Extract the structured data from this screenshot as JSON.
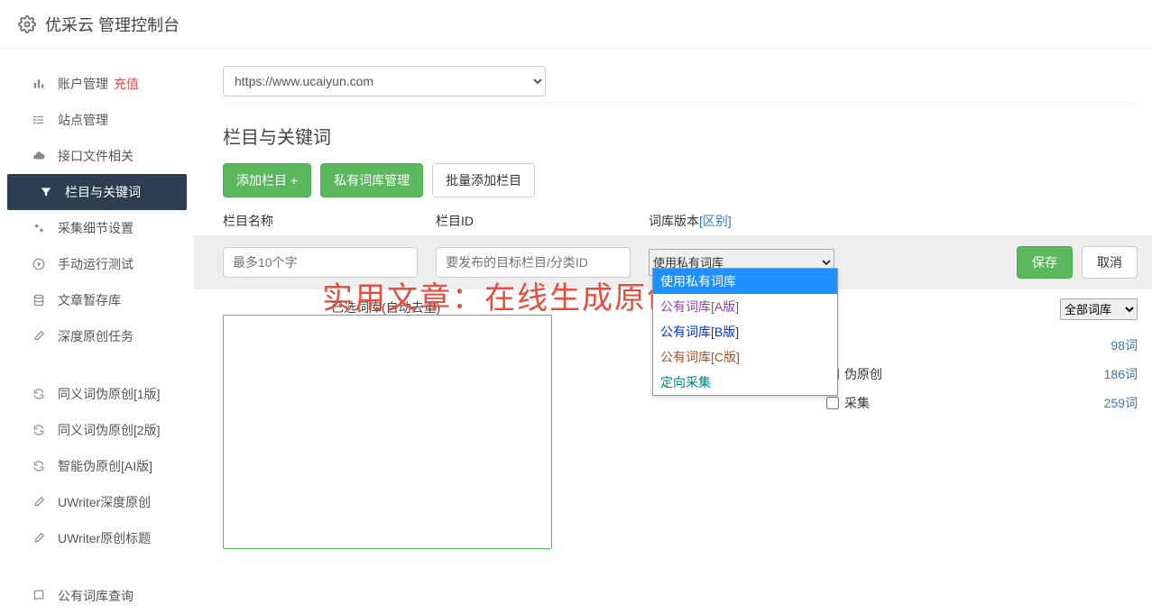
{
  "header": {
    "title": "优采云 管理控制台"
  },
  "sidebar": {
    "items": [
      {
        "label": "账户管理",
        "extra": "充值"
      },
      {
        "label": "站点管理"
      },
      {
        "label": "接口文件相关"
      },
      {
        "label": "栏目与关键词"
      },
      {
        "label": "采集细节设置"
      },
      {
        "label": "手动运行测试"
      },
      {
        "label": "文章暂存库"
      },
      {
        "label": "深度原创任务"
      }
    ],
    "items2": [
      {
        "label": "同义词伪原创[1版]"
      },
      {
        "label": "同义词伪原创[2版]"
      },
      {
        "label": "智能伪原创[AI版]"
      },
      {
        "label": "UWriter深度原创"
      },
      {
        "label": "UWriter原创标题"
      }
    ],
    "items3": [
      {
        "label": "公有词库查询"
      }
    ]
  },
  "main": {
    "site_select": "https://www.ucaiyun.com",
    "section_title": "栏目与关键词",
    "btn_add_col": "添加栏目 +",
    "btn_private_lex": "私有词库管理",
    "btn_batch_add": "批量添加栏目",
    "labels": {
      "col_name": "栏目名称",
      "col_id": "栏目ID",
      "lex_ver": "词库版本",
      "lex_diff": "[区别]"
    },
    "placeholders": {
      "col_name": "最多10个字",
      "col_id": "要发布的目标栏目/分类ID"
    },
    "select_lex_value": "使用私有词库",
    "btn_save": "保存",
    "btn_cancel": "取消",
    "selected_lex_label": "已选词库(自动去重)",
    "dropdown_options": [
      {
        "label": "使用私有词库",
        "cls": "sel"
      },
      {
        "label": "公有词库[A版]",
        "cls": "purple"
      },
      {
        "label": "公有词库[B版]",
        "cls": "blue"
      },
      {
        "label": "公有词库[C版]",
        "cls": "brown"
      },
      {
        "label": "定向采集",
        "cls": "teal"
      }
    ],
    "filter_select": "全部词库",
    "stats": [
      {
        "label": "",
        "count": "98词"
      },
      {
        "label": "伪原创",
        "count": "186词"
      },
      {
        "label": "采集",
        "count": "259词"
      }
    ],
    "watermark": "实用文章：在线生成原创文章"
  }
}
